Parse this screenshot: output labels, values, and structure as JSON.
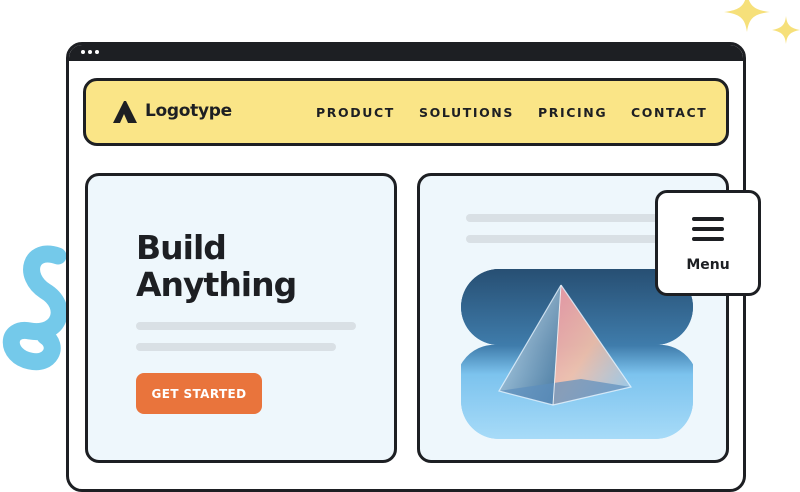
{
  "brand": {
    "name": "Logotype",
    "icon": "logotype-mark-icon"
  },
  "nav": {
    "links": [
      {
        "label": "PRODUCT"
      },
      {
        "label": "SOLUTIONS"
      },
      {
        "label": "PRICING"
      },
      {
        "label": "CONTACT"
      }
    ]
  },
  "hero": {
    "title_line1": "Build",
    "title_line2": "Anything",
    "cta_label": "GET STARTED"
  },
  "menu": {
    "label": "Menu",
    "icon": "hamburger-icon"
  },
  "colors": {
    "nav_background": "#fae587",
    "card_background": "#eef7fc",
    "cta_background": "#e9743c",
    "outline": "#1d1f23",
    "squiggle": "#74c9ea",
    "sparkle": "#f6e07a"
  }
}
